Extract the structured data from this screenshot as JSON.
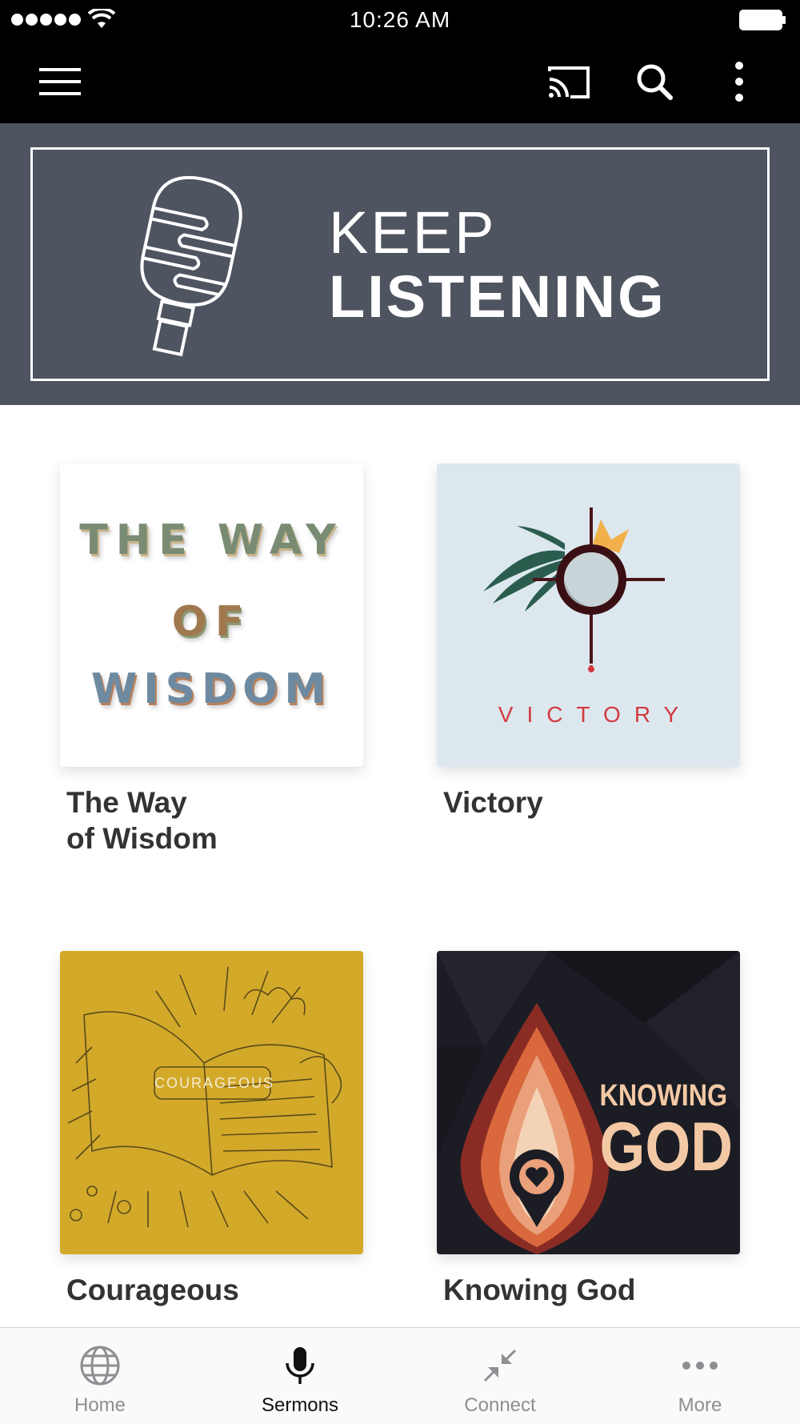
{
  "status_bar": {
    "time": "10:26 AM"
  },
  "app_bar": {
    "icons": [
      "menu-icon",
      "cast-icon",
      "search-icon",
      "more-vert-icon"
    ]
  },
  "banner": {
    "line1": "KEEP",
    "line2": "LISTENING"
  },
  "series": [
    {
      "title": "The Way of Wisdom",
      "title_line1": "The Way",
      "title_line2": "of Wisdom",
      "art": {
        "text_line1": "THE WAY",
        "text_line2": "OF",
        "text_line3": "WISDOM",
        "background": "#ffffff"
      }
    },
    {
      "title": "Victory",
      "art": {
        "text": "VICTORY",
        "background": "#dce8ee",
        "text_color": "#d23a3f"
      }
    },
    {
      "title": "Courageous",
      "art": {
        "text": "COURAGEOUS",
        "background": "#d3a92a"
      }
    },
    {
      "title": "Knowing God",
      "art": {
        "text_line1": "KNOWING",
        "text_line2": "GOD",
        "background": "#1c1d24",
        "text_color": "#f3c9a5"
      }
    }
  ],
  "tab_bar": {
    "active": "Sermons",
    "tabs": [
      {
        "label": "Home",
        "icon": "globe-icon"
      },
      {
        "label": "Sermons",
        "icon": "microphone-icon"
      },
      {
        "label": "Connect",
        "icon": "arrows-in-icon"
      },
      {
        "label": "More",
        "icon": "more-horiz-icon"
      }
    ]
  },
  "colors": {
    "banner_bg": "#4e5460",
    "active_tab": "#111111",
    "inactive_tab": "#8e8e93"
  }
}
